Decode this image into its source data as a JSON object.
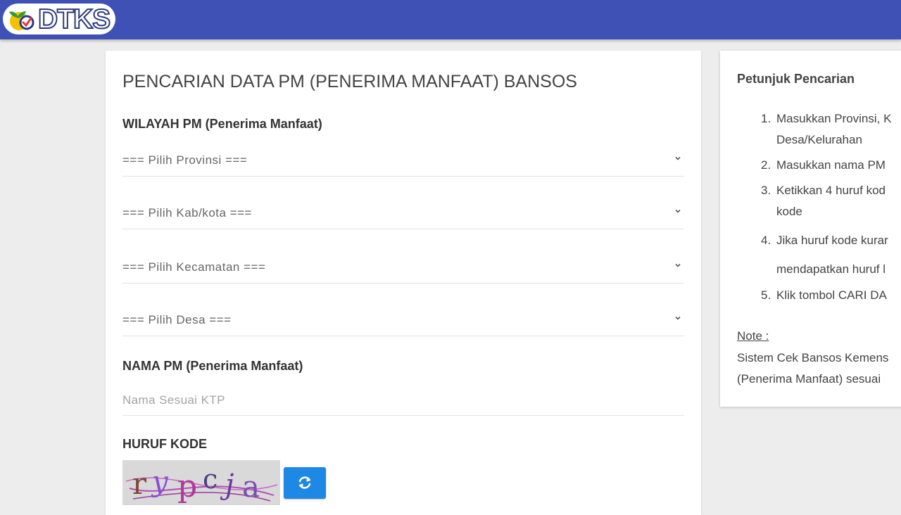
{
  "header": {
    "logo_text": "DTKS",
    "brand_color": "#3f51b5"
  },
  "main": {
    "title": "PENCARIAN DATA PM (PENERIMA MANFAAT) BANSOS",
    "wilayah_label": "WILAYAH PM (Penerima Manfaat)",
    "selects": [
      {
        "value": "=== Pilih Provinsi ==="
      },
      {
        "value": "=== Pilih Kab/kota ==="
      },
      {
        "value": "=== Pilih Kecamatan ==="
      },
      {
        "value": "=== Pilih Desa ==="
      }
    ],
    "nama_label": "NAMA PM (Penerima Manfaat)",
    "nama_placeholder": "Nama Sesuai KTP",
    "kode_label": "HURUF KODE",
    "captcha_text": "rypcja",
    "refresh_icon": "refresh-icon",
    "accent_color": "#1e88e5"
  },
  "sidebar": {
    "title": "Petunjuk Pencarian",
    "steps": [
      {
        "num": "1.",
        "line1": "Masukkan Provinsi, K",
        "line2": "Desa/Kelurahan"
      },
      {
        "num": "2.",
        "line1": "Masukkan nama PM"
      },
      {
        "num": "3.",
        "line1": "Ketikkan 4 huruf kod",
        "line2": "kode"
      },
      {
        "num": "4.",
        "line1": "Jika huruf kode kurar",
        "line2": "mendapatkan huruf l"
      },
      {
        "num": "5.",
        "line1": "Klik tombol CARI DA"
      }
    ],
    "note_label": "Note :",
    "note_line1": "Sistem Cek Bansos Kemens",
    "note_line2": "(Penerima Manfaat) sesuai "
  }
}
